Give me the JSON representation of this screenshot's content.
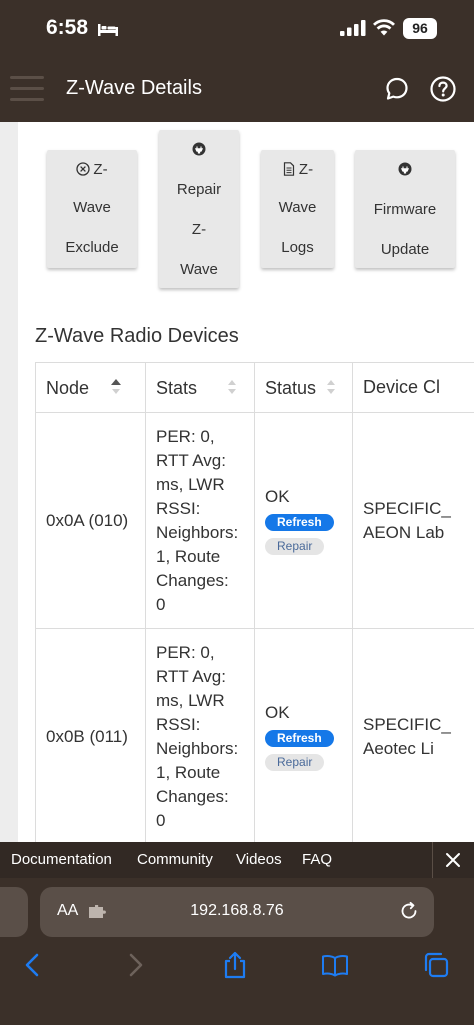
{
  "status_bar": {
    "time": "6:58",
    "battery": "96"
  },
  "header": {
    "title": "Z-Wave Details"
  },
  "actions": {
    "exclude": [
      "Z-",
      "Wave",
      "Exclude"
    ],
    "repair": [
      "Repair",
      "Z-",
      "Wave"
    ],
    "logs": [
      "Z-",
      "Wave",
      "Logs"
    ],
    "firmware": [
      "Firmware",
      "Update"
    ]
  },
  "section": {
    "title": "Z-Wave Radio Devices"
  },
  "table": {
    "headers": [
      "Node",
      "Stats",
      "Status",
      "Device Cl"
    ],
    "rows": [
      {
        "node": "0x0A (010)",
        "stats": [
          "PER: 0,",
          "RTT Avg:",
          "ms, LWR",
          "RSSI:",
          "Neighbors:",
          "1, Route",
          "Changes:",
          "0"
        ],
        "status": "OK",
        "refresh": "Refresh",
        "repair": "Repair",
        "device_class": [
          "SPECIFIC_",
          "AEON Lab"
        ]
      },
      {
        "node": "0x0B (011)",
        "stats": [
          "PER: 0,",
          "RTT Avg:",
          "ms, LWR",
          "RSSI:",
          "Neighbors:",
          "1, Route",
          "Changes:",
          "0"
        ],
        "status": "OK",
        "refresh": "Refresh",
        "repair": "Repair",
        "device_class": [
          "SPECIFIC_",
          "Aeotec Li"
        ]
      }
    ]
  },
  "quick_links": [
    "Documentation",
    "Community",
    "Videos",
    "FAQ"
  ],
  "browser": {
    "aa": "AA",
    "url": "192.168.8.76"
  },
  "colors": {
    "header_bg": "#3b3029",
    "accent_blue": "#1578e8",
    "ios_blue": "#1e7cf2"
  }
}
